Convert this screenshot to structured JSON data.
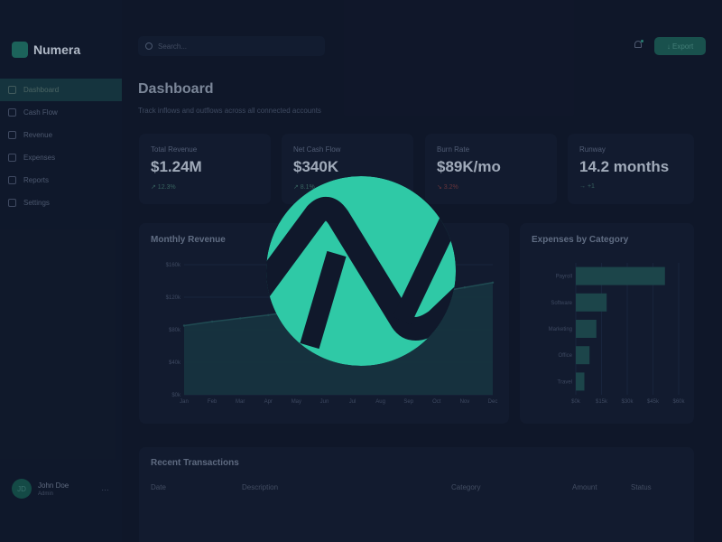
{
  "brand": {
    "name": "Numera",
    "logo_icon": "brand-logo-icon"
  },
  "colors": {
    "accent": "#2fc9a6",
    "background": "#10182b",
    "card": "#141d31",
    "negative": "#c04a55"
  },
  "sidebar": {
    "items": [
      {
        "label": "Dashboard",
        "icon": "grid-icon",
        "active": true
      },
      {
        "label": "Cash Flow",
        "icon": "trend-icon",
        "active": false
      },
      {
        "label": "Revenue",
        "icon": "dollar-icon",
        "active": false
      },
      {
        "label": "Expenses",
        "icon": "receipt-icon",
        "active": false
      },
      {
        "label": "Reports",
        "icon": "document-icon",
        "active": false
      },
      {
        "label": "Settings",
        "icon": "gear-icon",
        "active": false
      }
    ]
  },
  "user": {
    "initials": "JD",
    "name": "John Doe",
    "role": "Admin",
    "menu": "…"
  },
  "topbar": {
    "search_placeholder": "Search...",
    "export_label": "↓ Export"
  },
  "header": {
    "title": "Dashboard",
    "subtitle": "Track inflows and outflows across all connected accounts"
  },
  "kpis": [
    {
      "label": "Total Revenue",
      "value": "$1.24M",
      "trend": "↗ 12.3%"
    },
    {
      "label": "Net Cash Flow",
      "value": "$340K",
      "trend": "↗ 8.1%"
    },
    {
      "label": "Burn Rate",
      "value": "$89K/mo",
      "trend": "↘ 3.2%"
    },
    {
      "label": "Runway",
      "value": "14.2 months",
      "trend": "→ +1"
    }
  ],
  "revenue_chart": {
    "title": "Monthly Revenue"
  },
  "expenses_chart": {
    "title": "Expenses by Category"
  },
  "chart_data": [
    {
      "type": "area",
      "title": "Monthly Revenue",
      "x": [
        "Jan",
        "Feb",
        "Mar",
        "Apr",
        "May",
        "Jun",
        "Jul",
        "Aug",
        "Sep",
        "Oct",
        "Nov",
        "Dec"
      ],
      "values": [
        85,
        90,
        94,
        98,
        103,
        106,
        110,
        115,
        120,
        126,
        132,
        138
      ],
      "ylim": [
        0,
        160
      ],
      "yticks": [
        "$0k",
        "$40k",
        "$80k",
        "$120k",
        "$160k"
      ]
    },
    {
      "type": "bar",
      "orientation": "horizontal",
      "title": "Expenses by Category",
      "categories": [
        "Payroll",
        "Software",
        "Marketing",
        "Office",
        "Travel"
      ],
      "values": [
        52,
        18,
        12,
        8,
        5
      ],
      "xlim": [
        0,
        60
      ],
      "xticks": [
        "$0k",
        "$15k",
        "$30k",
        "$45k",
        "$60k"
      ]
    }
  ],
  "transactions": {
    "title": "Recent Transactions",
    "columns": [
      "Date",
      "Description",
      "Category",
      "Amount",
      "Status"
    ]
  }
}
